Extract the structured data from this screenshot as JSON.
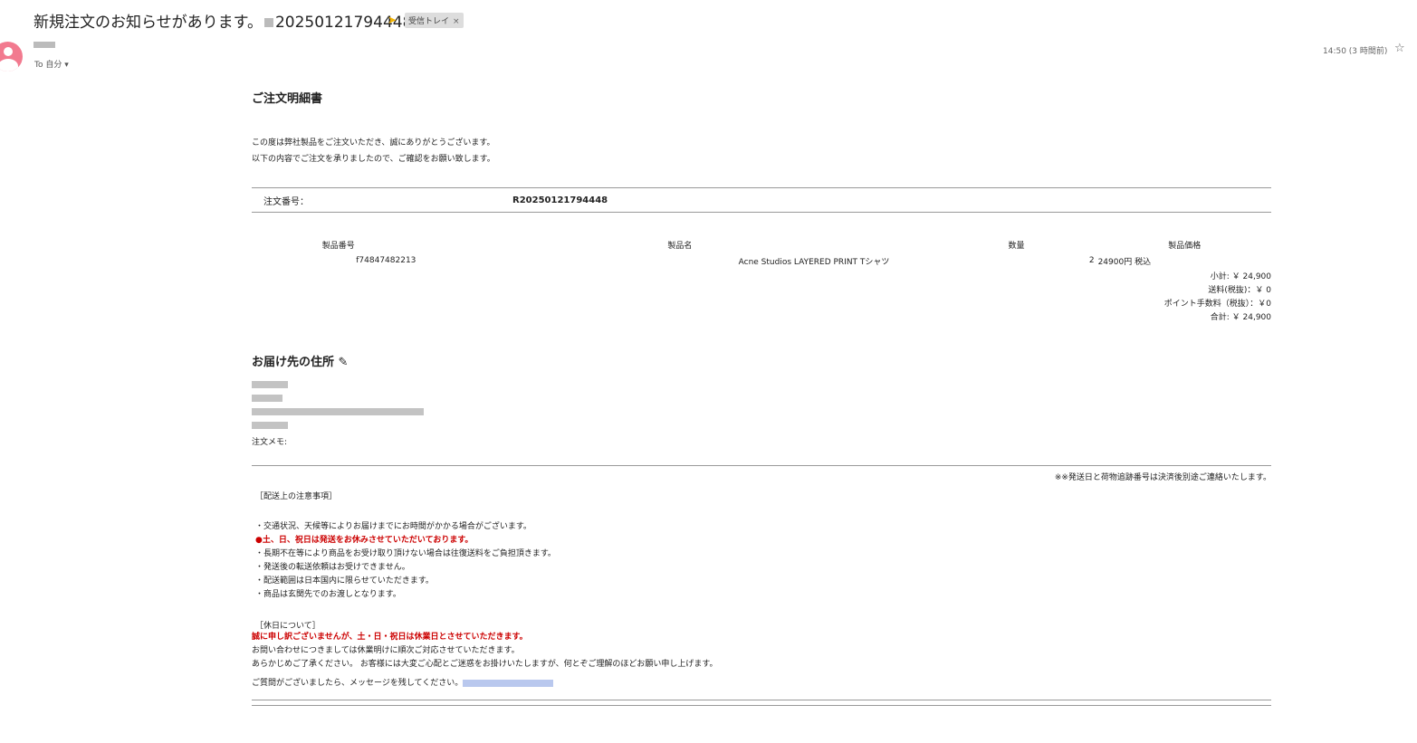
{
  "header": {
    "subject": "新規注文のお知らせがあります。",
    "subject_number": "20250121794448",
    "label": "受信トレイ",
    "label_close": "×",
    "important_icon": "important-marker-icon",
    "to": "To 自分",
    "time": "14:50 (3 時間前)",
    "star_icon": "star-icon"
  },
  "email": {
    "title": "ご注文明細書",
    "intro": [
      "この度は弊社製品をご注文いただき、誠にありがとうございます。",
      "以下の内容でご注文を承りましたので、ご確認をお願い致します。"
    ],
    "order_label": "注文番号：",
    "order_number": "R20250121794448",
    "table": {
      "headers": [
        "製品番号",
        "製品名",
        "数量",
        "製品価格"
      ],
      "row": {
        "code": "f74847482213",
        "name": "Acne Studios LAYERED PRINT Tシャツ",
        "qty": "2",
        "price": "24900円 税込"
      }
    },
    "totals": [
      "小計: ￥ 24,900",
      "送料(税抜)：￥ 0",
      "ポイント手数料（税抜）：￥0",
      "合計: ￥ 24,900"
    ],
    "address_title": "お届け先の住所",
    "memo_label": "注文メモ:",
    "notice_right": "※※発送日と荷物追跡番号は決済後別途ご連絡いたします。",
    "shipping_title": "［配送上の注意事項］",
    "shipping_items": [
      {
        "text": "・交通状況、天候等によりお届けまでにお時間がかかる場合がございます。",
        "red": false
      },
      {
        "text": "●土、日、祝日は発送をお休みさせていただいております。",
        "red": true
      },
      {
        "text": "・長期不在等により商品をお受け取り頂けない場合は往復送料をご負担頂きます。",
        "red": false
      },
      {
        "text": "・発送後の転送依頼はお受けできません。",
        "red": false
      },
      {
        "text": "・配送範囲は日本国内に限らせていただきます。",
        "red": false
      },
      {
        "text": "・商品は玄関先でのお渡しとなります。",
        "red": false
      }
    ],
    "holiday_title": "［休日について］",
    "holiday_red": "誠に申し訳ございませんが、土・日・祝日は休業日とさせていただきます。",
    "holiday_lines": [
      "お問い合わせにつきましては休業明けに順次ご対応させていただきます。",
      "あらかじめご了承ください。 お客様には大変ご心配とご迷惑をお掛けいたしますが、何とぞご理解のほどお願い申し上げます。"
    ],
    "question": "ご質問がございましたら、メッセージを残してください。"
  }
}
